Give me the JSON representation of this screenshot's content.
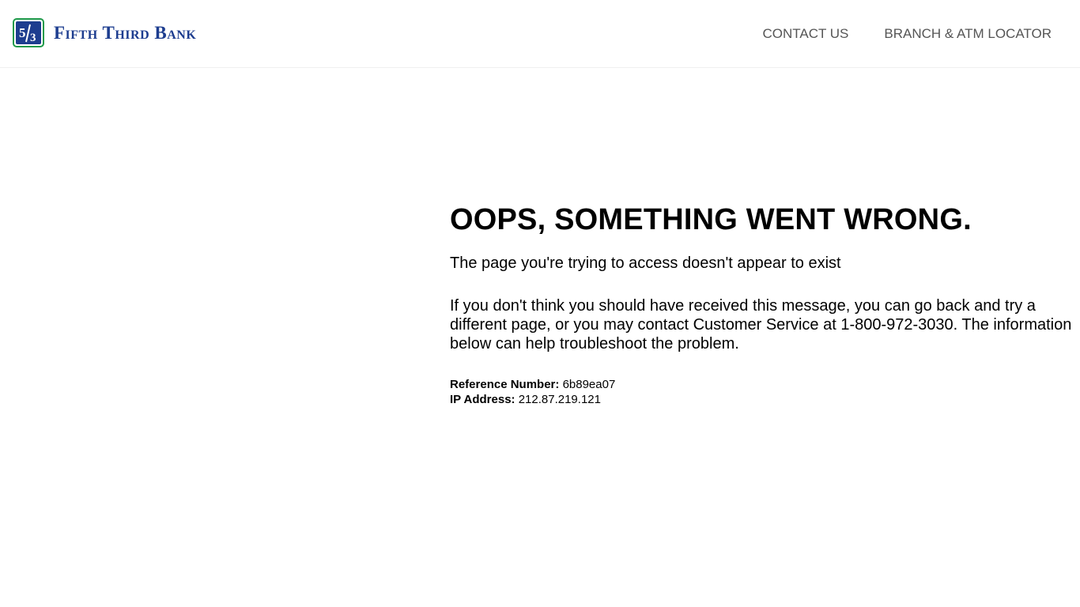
{
  "brand": {
    "name": "Fifth Third Bank",
    "mark_text": "5/3",
    "colors": {
      "blue": "#1d3d8f",
      "green": "#1f9a4a"
    }
  },
  "nav": {
    "items": [
      {
        "label": "CONTACT US"
      },
      {
        "label": "BRANCH & ATM LOCATOR"
      }
    ],
    "color": "#555555"
  },
  "error": {
    "title": "OOPS, SOMETHING WENT WRONG.",
    "subtitle": "The page you're trying to access doesn't appear to exist",
    "message": "If you don't think you should have received this message, you can go back and try a different page, or you may contact Customer Service at 1-800-972-3030. The information below can help troubleshoot the problem.",
    "reference_label": "Reference Number:",
    "reference_value": "6b89ea07",
    "ip_label": "IP Address:",
    "ip_value": "212.87.219.121"
  }
}
